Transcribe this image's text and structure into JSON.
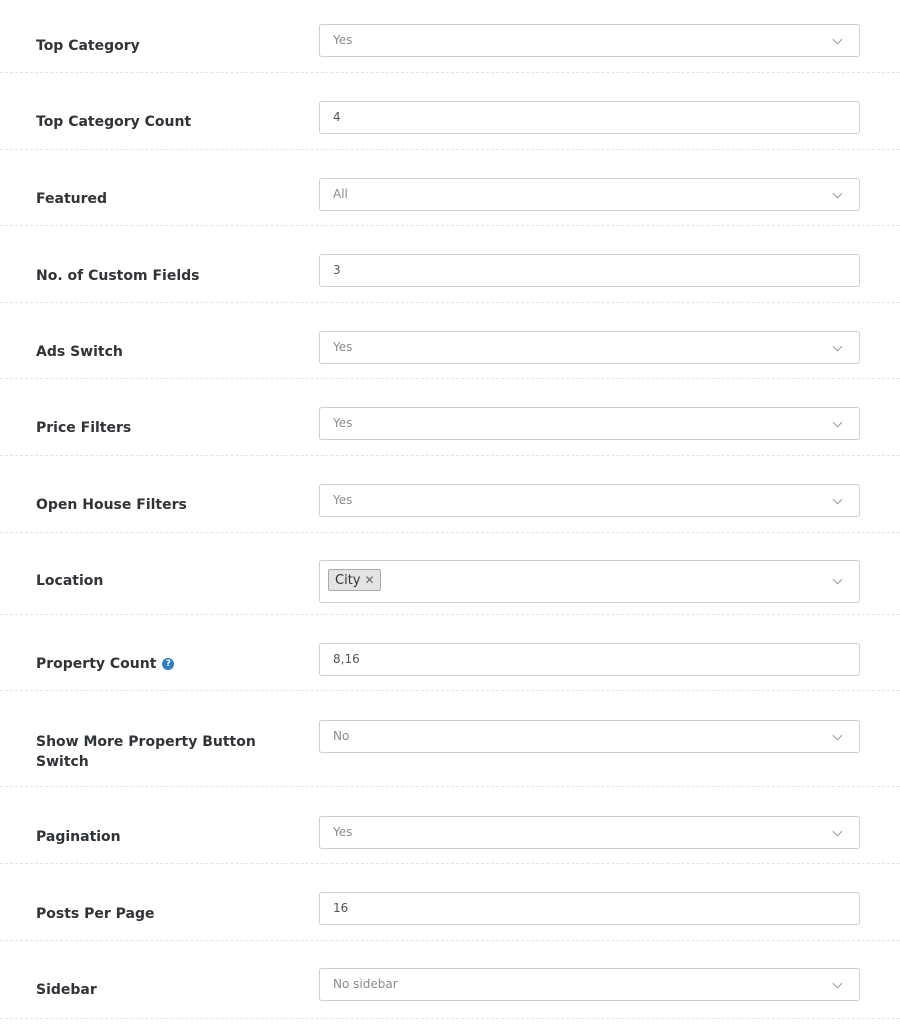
{
  "fields": {
    "top_category": {
      "label": "Top Category",
      "value": "Yes"
    },
    "top_category_count": {
      "label": "Top Category Count",
      "value": "4"
    },
    "featured": {
      "label": "Featured",
      "value": "All"
    },
    "custom_fields": {
      "label": "No. of Custom Fields",
      "value": "3"
    },
    "ads_switch": {
      "label": "Ads Switch",
      "value": "Yes"
    },
    "price_filters": {
      "label": "Price Filters",
      "value": "Yes"
    },
    "open_house_filters": {
      "label": "Open House Filters",
      "value": "Yes"
    },
    "location": {
      "label": "Location",
      "tags": [
        "City"
      ],
      "tag_remove": "✕"
    },
    "property_count": {
      "label": "Property Count",
      "help": "?",
      "value": "8,16"
    },
    "show_more_button": {
      "label": "Show More Property Button Switch",
      "value": "No"
    },
    "pagination": {
      "label": "Pagination",
      "value": "Yes"
    },
    "posts_per_page": {
      "label": "Posts Per Page",
      "value": "16"
    },
    "sidebar": {
      "label": "Sidebar",
      "value": "No sidebar"
    }
  },
  "colors": {
    "help_icon": "#2f7fc1",
    "border": "#cfcfcf",
    "divider": "#e3e3e3"
  }
}
